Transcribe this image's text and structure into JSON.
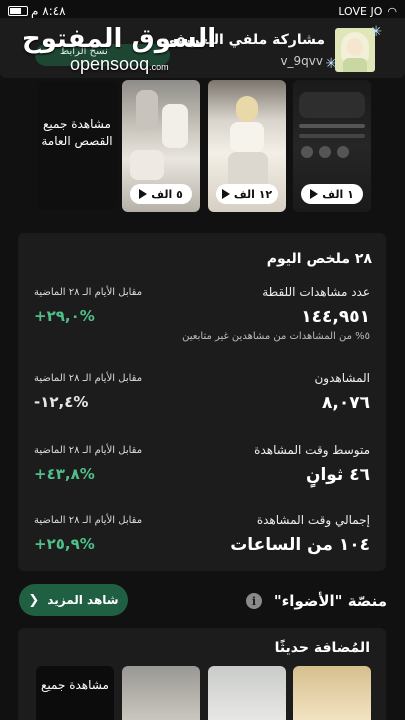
{
  "status_bar": {
    "carrier": "LOVE JO",
    "time": "٨:٤٨ م"
  },
  "share": {
    "title": "مشاركة ملفي التعريفي",
    "handle": "v_9qvv",
    "brand_arabic": "السوق المفتوح",
    "brand_latin": "opensooq",
    "brand_tld": ".com",
    "partial_button": "نسخ الرابط"
  },
  "stories": {
    "see_all": "مشاهدة جميع القصص العامة",
    "items": [
      {
        "views": "٥ الف"
      },
      {
        "views": "١٢ الف"
      },
      {
        "views": "١ الف"
      }
    ]
  },
  "summary": {
    "title": "٢٨ ملخص اليوم",
    "compare_label": "مقابل الأيام الـ ٢٨ الماضية",
    "metrics": [
      {
        "label": "عدد مشاهدات اللقطة",
        "value": "١٤٤,٩٥١",
        "note": "٥% من المشاهدات من مشاهدين غير متابعين",
        "change": "+٢٩,٠%"
      },
      {
        "label": "المشاهدون",
        "value": "٨,٠٧٦",
        "note": "",
        "change": "-١٢,٤%"
      },
      {
        "label": "متوسط وقت المشاهدة",
        "value": "٤٦ ثوانٍ",
        "note": "",
        "change": "+٤٣,٨%"
      },
      {
        "label": "إجمالي وقت المشاهدة",
        "value": "١٠٤ من الساعات",
        "note": "",
        "change": "+٢٥,٩%"
      }
    ]
  },
  "spotlight": {
    "title": "منصّة \"الأضواء\"",
    "see_more": "شاهد المزيد"
  },
  "recent": {
    "title": "المُضافة حديثًا",
    "see_all": "مشاهدة جميع"
  },
  "colors": {
    "accent_green": "#1f5f42",
    "positive": "#4fbf89",
    "card": "#1c1c1c",
    "background": "#111111"
  }
}
